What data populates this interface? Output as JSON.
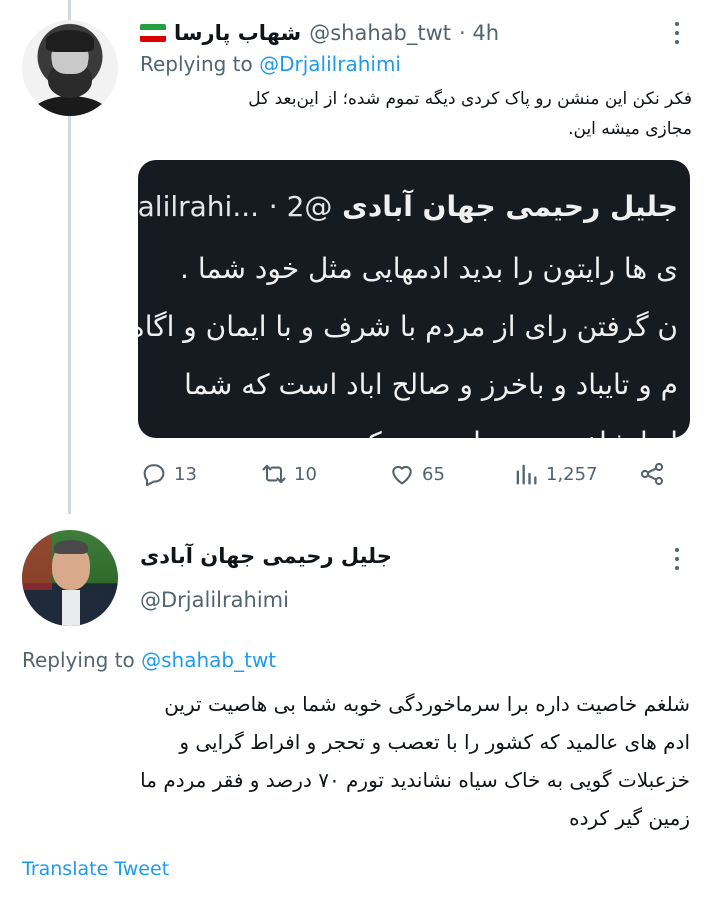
{
  "tweet1": {
    "display_name": "شهاب پارسا",
    "handle": "@shahab_twt",
    "time": "· 4h",
    "replying_prefix": "Replying to ",
    "replying_handle": "@Drjalilrahimi",
    "text_line1": "فکر نکن این منشن رو پاک کردی دیگه تموم شده؛ از این‌بعد کل",
    "text_line2": "مجازی میشه این.",
    "flag_colors": [
      "#239f40",
      "#ffffff",
      "#da0000"
    ],
    "quote": {
      "name": "جلیل رحیمی جهان آبادی",
      "handle": "@Drjalilrahi...",
      "suffix": "· 2",
      "lines": [
        "ی ها رایتون را بدید ادمهایی مثل خود شما .",
        "ن گرفتن رای از مردم با شرف و با ایمان و اگاه",
        "م و تایباد و باخرز و صالح اباد است که شما",
        "ا را شلغم هم‌حساب نمی کنند"
      ]
    },
    "actions": {
      "reply_count": "13",
      "retweet_count": "10",
      "like_count": "65",
      "views_count": "1,257"
    }
  },
  "tweet2": {
    "display_name": "جلیل رحیمی جهان آبادی",
    "handle": "@Drjalilrahimi",
    "replying_prefix": "Replying to ",
    "replying_handle": "@shahab_twt",
    "lines": [
      "شلغم خاصیت داره برا سرماخوردگی خوبه شما بی هاصیت ترین",
      "ادم های عالمید که کشور را با تعصب و تحجر و افراط گرایی و",
      "خزعبلات گویی به خاک سیاه نشاندید تورم ۷۰ درصد و فقر مردم ما",
      "زمین گیر کرده"
    ],
    "translate_label": "Translate Tweet"
  },
  "colors": {
    "accent": "#1d9bf0",
    "muted": "#536471",
    "quote_bg": "#161b22"
  }
}
